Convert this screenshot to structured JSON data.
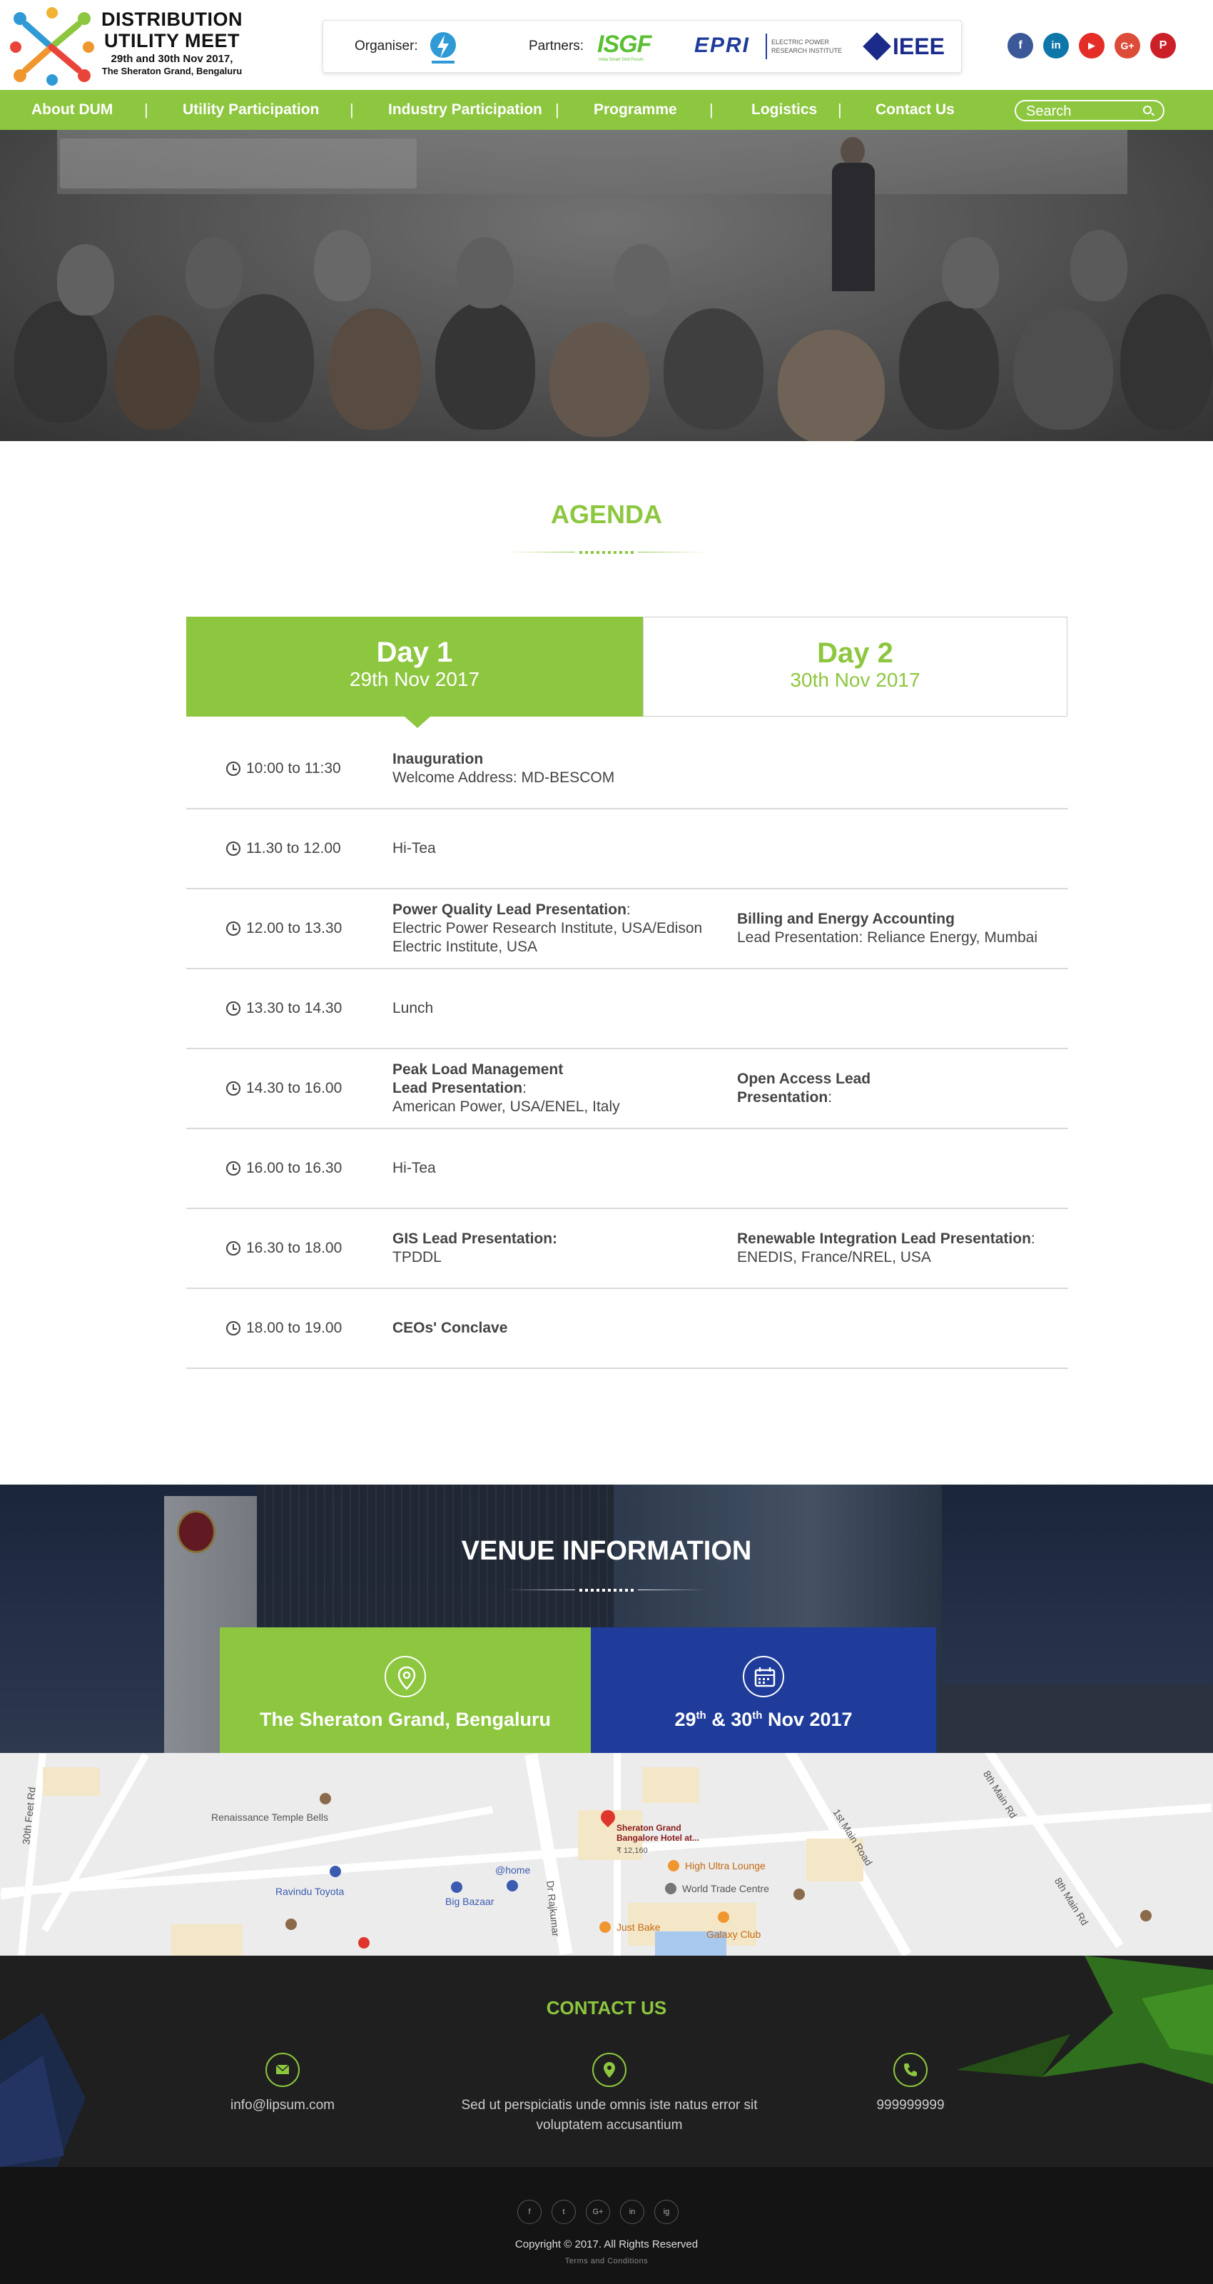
{
  "logo": {
    "title_line1": "DISTRIBUTION",
    "title_line2": "UTILITY MEET",
    "dates": "29th and 30th Nov 2017,",
    "venue": "The Sheraton Grand, Bengaluru"
  },
  "partners_bar": {
    "organiser_label": "Organiser:",
    "partners_label": "Partners:",
    "isgf": "ISGF",
    "isgf_sub": "India Smart Grid Forum",
    "epri": "EPRI",
    "epri_sub": "ELECTRIC POWER RESEARCH INSTITUTE",
    "ieee": "IEEE"
  },
  "social_top": [
    {
      "icon": "facebook-icon",
      "glyph": "f",
      "color": "#3b5998"
    },
    {
      "icon": "linkedin-icon",
      "glyph": "in",
      "color": "#0e76a8"
    },
    {
      "icon": "youtube-icon",
      "glyph": "▶",
      "color": "#e52d27"
    },
    {
      "icon": "google-plus-icon",
      "glyph": "G+",
      "color": "#dd4b39"
    },
    {
      "icon": "pinterest-icon",
      "glyph": "P",
      "color": "#cb2027"
    }
  ],
  "nav": {
    "items": [
      "About DUM",
      "Utility Participation",
      "Industry Participation",
      "Programme",
      "Logistics",
      "Contact Us"
    ],
    "separator": "|",
    "search_placeholder": "Search"
  },
  "agenda": {
    "title": "AGENDA",
    "day1": {
      "label": "Day 1",
      "date": "29th Nov 2017"
    },
    "day2": {
      "label": "Day 2",
      "date": "30th Nov 2017"
    },
    "rows": [
      {
        "time": "10:00 to 11:30",
        "c1_bold": "Inauguration",
        "c1_text": "Welcome Address: MD-BESCOM",
        "c2_bold": "",
        "c2_text": ""
      },
      {
        "time": "11.30 to 12.00",
        "c1_bold": "",
        "c1_text": "Hi-Tea",
        "c2_bold": "",
        "c2_text": ""
      },
      {
        "time": "12.00 to 13.30",
        "c1_bold": "Power Quality Lead Presentation",
        "c1_text": "Electric Power Research Institute, USA/Edison Electric Institute, USA",
        "c2_bold": "Billing and Energy Accounting",
        "c2_text": "Lead Presentation: Reliance Energy, Mumbai"
      },
      {
        "time": "13.30 to 14.30",
        "c1_bold": "",
        "c1_text": "Lunch",
        "c2_bold": "",
        "c2_text": ""
      },
      {
        "time": "14.30 to 16.00",
        "c1_bold": "Peak Load Management Lead Presentation",
        "c1_text": "American Power, USA/ENEL, Italy",
        "c2_bold": "Open Access Lead Presentation",
        "c2_text": ""
      },
      {
        "time": "16.00 to 16.30",
        "c1_bold": "",
        "c1_text": "Hi-Tea",
        "c2_bold": "",
        "c2_text": ""
      },
      {
        "time": "16.30 to 18.00",
        "c1_bold": "GIS Lead Presentation:",
        "c1_text": "TPDDL",
        "c2_bold": "Renewable Integration Lead Presentation",
        "c2_text": "ENEDIS, France/NREL, USA"
      },
      {
        "time": "18.00 to 19.00",
        "c1_bold": "CEOs' Conclave",
        "c1_text": "",
        "c2_bold": "",
        "c2_text": ""
      }
    ]
  },
  "venue": {
    "title": "VENUE INFORMATION",
    "location": "The Sheraton Grand, Bengaluru",
    "date_a": "29",
    "date_a_sup": "th",
    "date_amp": " & ",
    "date_b": "30",
    "date_b_sup": "th",
    "date_rest": " Nov 2017"
  },
  "map": {
    "labels": {
      "renaissance": "Renaissance Temple Bells",
      "ravindu": "Ravindu Toyota",
      "bigbazaar": "Big Bazaar",
      "home": "@home",
      "sheraton": "Sheraton Grand Bangalore Hotel at...",
      "price": "₹ 12,160",
      "highultra": "High Ultra Lounge",
      "wtc": "World Trade Centre",
      "justbake": "Just Bake",
      "galaxy": "Galaxy Club",
      "firstmain": "1st Main Road",
      "eighthmain": "8th Main Rd",
      "eighthmain2": "8th Main Rd",
      "thirtyfeet": "30th Feet Rd",
      "rajkumar": "Dr Rajkumar"
    }
  },
  "contact": {
    "title": "CONTACT US",
    "email": "info@lipsum.com",
    "address": "Sed ut perspiciatis unde omnis iste natus error sit voluptatem accusantium",
    "phone": "999999999"
  },
  "footer": {
    "social": [
      "f",
      "t",
      "G+",
      "in",
      "ig"
    ],
    "copyright": "Copyright © 2017. All Rights Reserved",
    "terms": "Terms and Conditions"
  },
  "colors": {
    "green": "#8dc63f",
    "blue": "#1f3c9b",
    "dark": "#1f1f1f"
  }
}
